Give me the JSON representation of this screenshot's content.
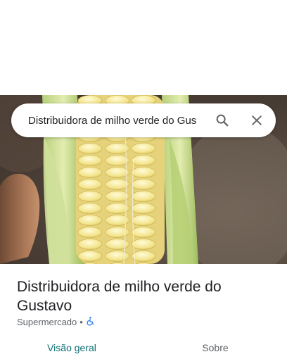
{
  "search": {
    "value": "Distribuidora de milho verde do Gus",
    "search_icon": "search-icon",
    "close_icon": "close-icon"
  },
  "hero": {
    "image": "corn-cob-photo"
  },
  "place": {
    "title": "Distribuidora de milho verde do Gustavo",
    "category": "Supermercado",
    "separator": "•",
    "accessibility_icon": "wheelchair-icon"
  },
  "tabs": [
    {
      "label": "Visão geral",
      "active": true
    },
    {
      "label": "Sobre",
      "active": false
    }
  ],
  "colors": {
    "accent": "#0b6e75",
    "accessibility": "#1a73e8",
    "text_primary": "#202124",
    "text_secondary": "#5f6368"
  }
}
